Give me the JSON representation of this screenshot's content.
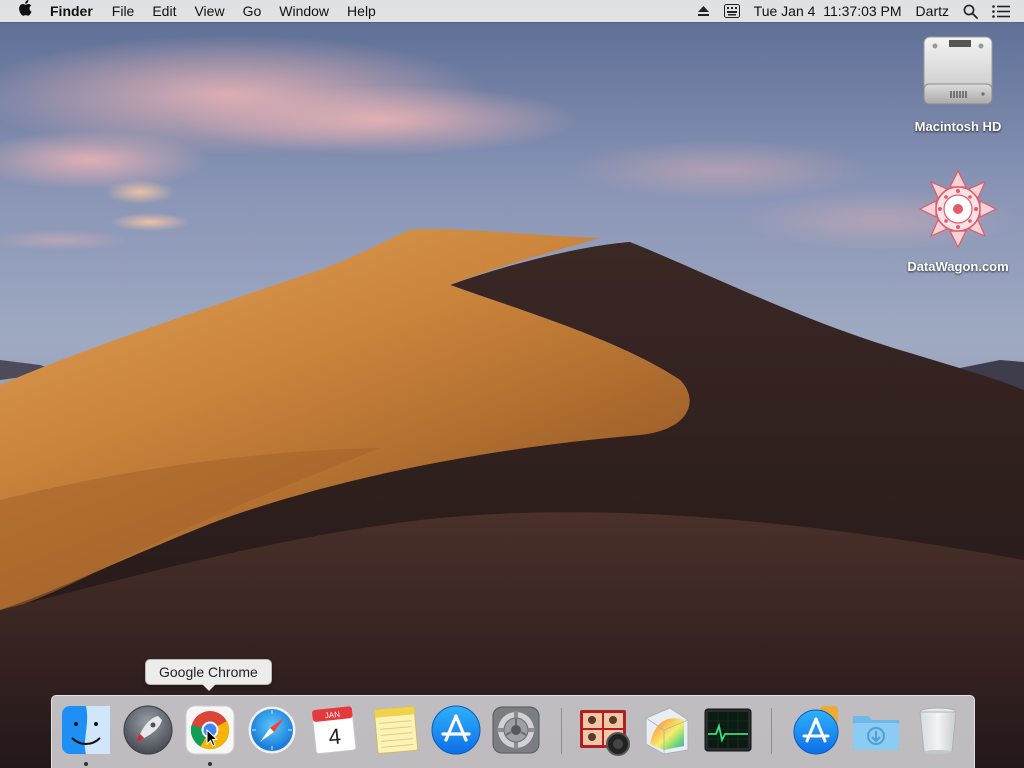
{
  "menubar": {
    "apple": "",
    "app_name": "Finder",
    "menus": [
      "File",
      "Edit",
      "View",
      "Go",
      "Window",
      "Help"
    ],
    "datetime": "Tue Jan 4  11:37:03 PM",
    "user": "Dartz"
  },
  "desktop_icons": [
    {
      "label": "Macintosh HD",
      "icon": "hard-drive-icon"
    },
    {
      "label": "DataWagon.com",
      "icon": "datawagon-logo-icon"
    }
  ],
  "tooltip": "Google Chrome",
  "dock": {
    "apps": [
      {
        "name": "Finder",
        "icon": "finder-icon",
        "running": true
      },
      {
        "name": "Launchpad",
        "icon": "launchpad-icon",
        "running": false
      },
      {
        "name": "Google Chrome",
        "icon": "chrome-icon",
        "running": true
      },
      {
        "name": "Safari",
        "icon": "safari-icon",
        "running": false
      },
      {
        "name": "Calendar",
        "icon": "calendar-icon",
        "running": false,
        "month": "JAN",
        "day": "4"
      },
      {
        "name": "Notes",
        "icon": "notes-icon",
        "running": false
      },
      {
        "name": "App Store",
        "icon": "app-store-icon",
        "running": false
      },
      {
        "name": "System Preferences",
        "icon": "system-preferences-icon",
        "running": false
      },
      {
        "name": "Photo Booth",
        "icon": "photo-booth-icon",
        "running": false
      },
      {
        "name": "Grapher",
        "icon": "grapher-icon",
        "running": false
      },
      {
        "name": "Activity Monitor",
        "icon": "activity-monitor-icon",
        "running": false
      },
      {
        "name": "Applications",
        "icon": "applications-stack-icon",
        "running": false
      },
      {
        "name": "Downloads",
        "icon": "downloads-folder-icon",
        "running": false
      },
      {
        "name": "Trash",
        "icon": "trash-icon",
        "running": false
      }
    ]
  },
  "colors": {
    "menubar_bg": "#ececec",
    "dock_bg": "#e1e1e4",
    "dune_light": "#d6913f",
    "dune_shadow": "#3a2622"
  }
}
